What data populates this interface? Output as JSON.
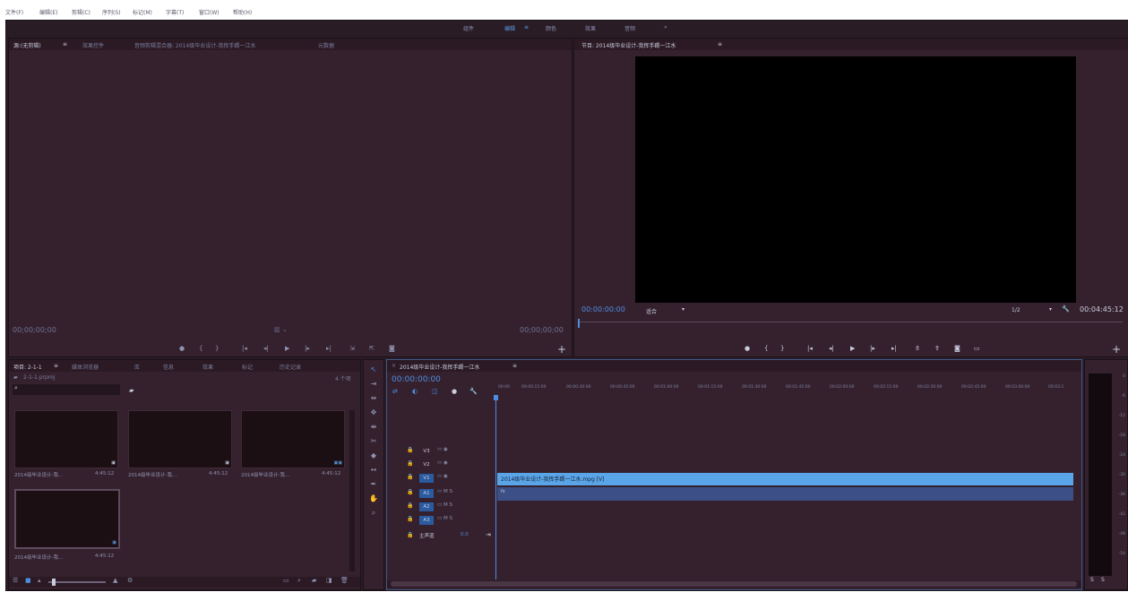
{
  "menubar": {
    "items": [
      "文件(F)",
      "编辑(E)",
      "剪辑(C)",
      "序列(S)",
      "标记(M)",
      "字幕(T)",
      "窗口(W)",
      "帮助(H)"
    ]
  },
  "workspaces": {
    "items": [
      "组件",
      "编辑",
      "颜色",
      "效果",
      "音频",
      "»"
    ],
    "active_label": "编辑",
    "active_menu_icon": "≡"
  },
  "source_panel": {
    "tabs": [
      "源:(无剪辑)",
      "效果控件",
      "音频剪辑混合器: 2014级毕业设计-我挥手踢一江水",
      "元数据"
    ],
    "timecode_left": "00;00;00;00",
    "timecode_right": "00;00;00;00"
  },
  "program_panel": {
    "title": "节目: 2014级毕业设计-我挥手踢一江水",
    "timecode_left": "00:00:00:00",
    "fit_label": "适合",
    "ratio_label": "1/2",
    "timecode_right": "00:04:45:12"
  },
  "project_panel": {
    "tabs": [
      "项目: 2-1-1",
      "媒体浏览器",
      "库",
      "信息",
      "效果",
      "标记",
      "历史记录"
    ],
    "project_file": "2-1-1.prproj",
    "item_count": "4 个项",
    "items": [
      {
        "name": "2014级毕业设计-我...",
        "duration": "4:45:12"
      },
      {
        "name": "2014级毕业设计-我...",
        "duration": "4:45:12"
      },
      {
        "name": "2014级毕业设计-我...",
        "duration": "4:45:12"
      },
      {
        "name": "2014级毕业设计-我...",
        "duration": "4:45:12"
      }
    ]
  },
  "timeline": {
    "title": "2014级毕业设计-我挥手踢一江水",
    "timecode": "00:00:00:00",
    "ruler": [
      "00:00",
      "00:00:15:00",
      "00:00:30:00",
      "00:00:45:00",
      "00:01:00:00",
      "00:01:15:00",
      "00:01:30:00",
      "00:01:45:00",
      "00:02:00:00",
      "00:02:15:00",
      "00:02:30:00",
      "00:02:45:00",
      "00:03:00:00",
      "00:03:1"
    ],
    "tracks": [
      {
        "name": "V3",
        "icons": "▭ ◉",
        "selected": false
      },
      {
        "name": "V2",
        "icons": "▭ ◉",
        "selected": false
      },
      {
        "name": "V1",
        "icons": "▭ ◉",
        "selected": true
      },
      {
        "name": "A1",
        "icons": "▭ M S",
        "selected": true
      },
      {
        "name": "A2",
        "icons": "▭ M S",
        "selected": true
      },
      {
        "name": "A3",
        "icons": "▭ M S",
        "selected": true
      }
    ],
    "master_label": "主声道",
    "master_value": "0.0",
    "clip_label": "2014级毕业设计-我挥手踢一江水.mpg [V]",
    "audio_clip_badge": "fx"
  },
  "audio_meter": {
    "ticks": [
      "0",
      "-6",
      "-12",
      "-18",
      "-24",
      "-30",
      "-36",
      "-42",
      "-48",
      "-54"
    ],
    "solo_left": "S",
    "solo_right": "S"
  },
  "colors": {
    "accent": "#4d8ce0",
    "clip": "#59a5e8",
    "audio_clip": "#3c4f86",
    "panel_bg": "#35212d"
  }
}
